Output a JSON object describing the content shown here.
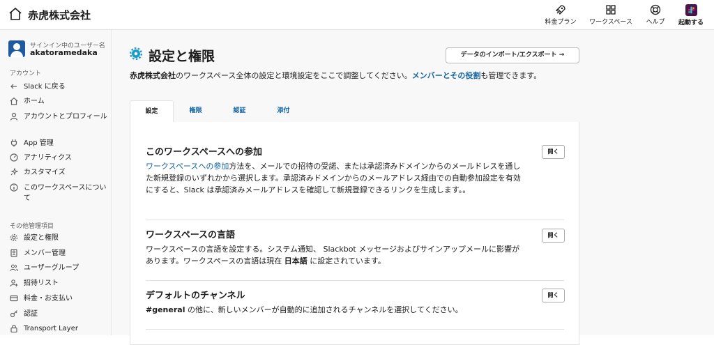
{
  "header": {
    "workspace_name": "赤虎株式会社",
    "nav": [
      {
        "label": "料金プラン",
        "icon": "rocket-icon"
      },
      {
        "label": "ワークスペース",
        "icon": "grid-icon"
      },
      {
        "label": "ヘルプ",
        "icon": "help-ring-icon"
      },
      {
        "label": "起動する",
        "icon": "slack-logo-icon"
      }
    ]
  },
  "sidebar": {
    "user_caption": "サインイン中のユーザー名",
    "username": "akatoramedaka",
    "section1_title": "アカウント",
    "section1_items": [
      {
        "label": "Slack に戻る",
        "icon": "back-arrow-icon"
      },
      {
        "label": "ホーム",
        "icon": "home-icon"
      },
      {
        "label": "アカウントとプロフィール",
        "icon": "person-icon"
      },
      {
        "label": "App 管理",
        "icon": "plug-icon"
      },
      {
        "label": "アナリティクス",
        "icon": "gauge-icon"
      },
      {
        "label": "カスタマイズ",
        "icon": "sparkle-icon"
      },
      {
        "label": "このワークスペースについて",
        "icon": "info-icon"
      }
    ],
    "section2_title": "その他管理項目",
    "section2_items": [
      {
        "label": "設定と権限",
        "icon": "gear-icon"
      },
      {
        "label": "メンバー管理",
        "icon": "member-card-icon"
      },
      {
        "label": "ユーザーグループ",
        "icon": "users-icon"
      },
      {
        "label": "招待リスト",
        "icon": "add-person-icon"
      },
      {
        "label": "料金・お支払い",
        "icon": "credit-card-icon"
      },
      {
        "label": "認証",
        "icon": "key-icon"
      },
      {
        "label": "Transport Layer Security",
        "icon": "lock-icon"
      }
    ]
  },
  "main": {
    "title": "設定と権限",
    "export_button": "データのインポート/エクスポート →",
    "description": {
      "ws_name": "赤虎株式会社",
      "text1": "のワークスペース全体の設定と環境設定をここで調整してください。",
      "link": "メンバーとその役割",
      "text2": "も管理できます。"
    },
    "tabs": [
      "設定",
      "権限",
      "認証",
      "添付"
    ],
    "sections": [
      {
        "title": "このワークスペースへの参加",
        "link": "ワークスペースへの参加",
        "body": "方法を、メールでの招待の受諾、または承認済みドメインからのメールドレスを通した新規登録のいずれかから選択します。承認済みドメインからのメールアドレス経由での自動参加設定を有効にすると、Slack は承認済みメールアドレスを確認して新規登録できるリンクを生成します。。",
        "button": "開く"
      },
      {
        "title": "ワークスペースの言語",
        "body": "ワークスペースの言語を設定する。システム通知、 Slackbot メッセージおよびサインアップメールに影響があります。ワークスペースの言語は現在 ",
        "bold": "日本語",
        "body2": " に設定されています。",
        "button": "開く"
      },
      {
        "title": "デフォルトのチャンネル",
        "bold": "#general",
        "body": " の他に、新しいメンバーが自動的に追加されるチャンネルを選択してください。",
        "button": "開く"
      }
    ]
  }
}
